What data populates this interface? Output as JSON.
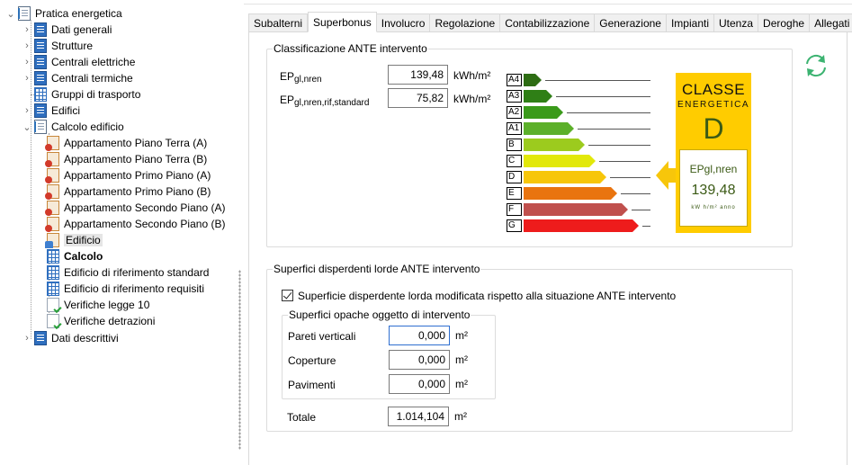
{
  "tree": {
    "items": [
      {
        "label": "Pratica energetica"
      },
      {
        "label": "Dati generali"
      },
      {
        "label": "Strutture"
      },
      {
        "label": "Centrali elettriche"
      },
      {
        "label": "Centrali termiche"
      },
      {
        "label": "Gruppi di trasporto"
      },
      {
        "label": "Edifici"
      },
      {
        "label": "Calcolo edificio"
      },
      {
        "label": "Appartamento Piano Terra (A)"
      },
      {
        "label": "Appartamento Piano Terra (B)"
      },
      {
        "label": "Appartamento Primo Piano (A)"
      },
      {
        "label": "Appartamento Primo Piano (B)"
      },
      {
        "label": "Appartamento Secondo Piano (A)"
      },
      {
        "label": "Appartamento Secondo Piano (B)"
      },
      {
        "label": "Edificio"
      },
      {
        "label": "Calcolo"
      },
      {
        "label": "Edificio di riferimento standard"
      },
      {
        "label": "Edificio di riferimento requisiti"
      },
      {
        "label": "Verifiche legge 10"
      },
      {
        "label": "Verifiche detrazioni"
      },
      {
        "label": "Dati descrittivi"
      }
    ],
    "expand_icons": {
      "expanded": "⌄",
      "collapsed": "›"
    }
  },
  "tabs": [
    {
      "label": "Subalterni"
    },
    {
      "label": "Superbonus"
    },
    {
      "label": "Involucro"
    },
    {
      "label": "Regolazione"
    },
    {
      "label": "Contabilizzazione"
    },
    {
      "label": "Generazione"
    },
    {
      "label": "Impianti"
    },
    {
      "label": "Utenza"
    },
    {
      "label": "Deroghe"
    },
    {
      "label": "Allegati"
    }
  ],
  "active_tab": "Superbonus",
  "classificazione": {
    "title": "Classificazione ANTE intervento",
    "ep_label_main": "EP",
    "ep_label_sub": "gl,nren",
    "ep_value": "139,48",
    "ep_unit": "kWh/m²",
    "ep_rif_label_main": "EP",
    "ep_rif_label_sub": "gl,nren,rif,standard",
    "ep_rif_value": "75,82",
    "ep_rif_unit": "kWh/m²",
    "classes": [
      {
        "label": "A4",
        "color": "#2e6d14"
      },
      {
        "label": "A3",
        "color": "#2f7f16"
      },
      {
        "label": "A2",
        "color": "#3a9a1a"
      },
      {
        "label": "A1",
        "color": "#5cb02a"
      },
      {
        "label": "B",
        "color": "#9ccb1e"
      },
      {
        "label": "C",
        "color": "#e2e80a"
      },
      {
        "label": "D",
        "color": "#f7c60a"
      },
      {
        "label": "E",
        "color": "#e9740f"
      },
      {
        "label": "F",
        "color": "#c0504d"
      },
      {
        "label": "G",
        "color": "#ee1c1c"
      }
    ],
    "badge": {
      "classe": "CLASSE",
      "energetica": "ENERGETICA",
      "letter": "D",
      "ep_label": "EPgl,nren",
      "ep_value": "139,48",
      "ep_unit": "kW h/m² anno",
      "color": "#ffcc00"
    }
  },
  "superfici": {
    "title": "Superfici disperdenti lorde ANTE intervento",
    "checkbox_label": "Superficie disperdente lorda modificata rispetto alla situazione ANTE intervento",
    "checkbox_checked": true,
    "opache_title": "Superfici opache oggetto di intervento",
    "rows": [
      {
        "label": "Pareti verticali",
        "value": "0,000",
        "unit": "m²"
      },
      {
        "label": "Coperture",
        "value": "0,000",
        "unit": "m²"
      },
      {
        "label": "Pavimenti",
        "value": "0,000",
        "unit": "m²"
      }
    ],
    "totale_label": "Totale",
    "totale_value": "1.014,104",
    "totale_unit": "m²"
  }
}
